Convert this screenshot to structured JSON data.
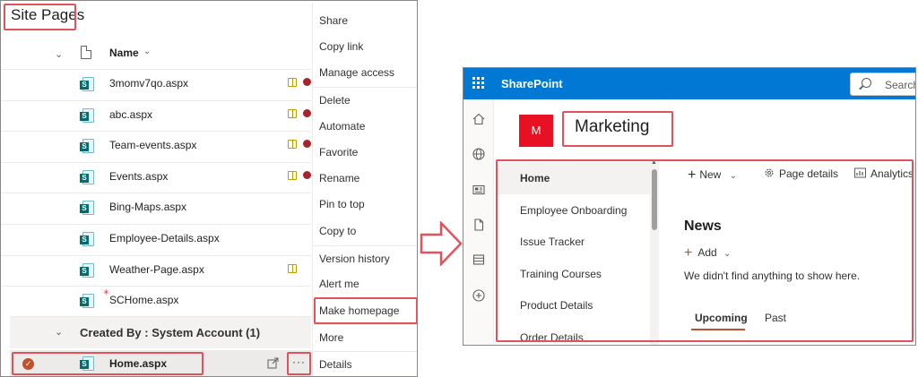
{
  "left": {
    "title": "Site Pages",
    "column_name": "Name",
    "files": [
      {
        "name": "3momv7qo.aspx",
        "book": true,
        "blocked": true
      },
      {
        "name": "abc.aspx",
        "book": true,
        "blocked": true
      },
      {
        "name": "Team-events.aspx",
        "book": true,
        "blocked": true
      },
      {
        "name": "Events.aspx",
        "book": true,
        "blocked": true
      },
      {
        "name": "Bing-Maps.aspx",
        "book": false,
        "blocked": false
      },
      {
        "name": "Employee-Details.aspx",
        "book": false,
        "blocked": false
      },
      {
        "name": "Weather-Page.aspx",
        "book": true,
        "blocked": false
      },
      {
        "name": "SCHome.aspx",
        "book": false,
        "blocked": false,
        "new": true
      }
    ],
    "group_label": "Created By : System Account (1)",
    "selected_file": "Home.aspx"
  },
  "context_menu": {
    "items": [
      "Share",
      "Copy link",
      "Manage access",
      "Delete",
      "Automate",
      "Favorite",
      "Rename",
      "Pin to top",
      "Copy to",
      "Version history",
      "Alert me",
      "Make homepage",
      "More",
      "Details"
    ]
  },
  "sharepoint": {
    "brand": "SharePoint",
    "search_placeholder": "Search",
    "site_logo": "M",
    "site_title": "Marketing",
    "nav": [
      "Home",
      "Employee Onboarding",
      "Issue Tracker",
      "Training Courses",
      "Product Details",
      "Order Details"
    ],
    "commands": {
      "new": "New",
      "page_details": "Page details",
      "analytics": "Analytics"
    },
    "news_title": "News",
    "add_label": "Add",
    "empty_text": "We didn't find anything to show here.",
    "tabs": [
      "Upcoming",
      "Past"
    ]
  },
  "colors": {
    "sp_blue": "#0078d4",
    "highlight_red": "#e0535b",
    "site_logo_red": "#e81123",
    "accent_orange": "#c1502e"
  },
  "icons": [
    "chevron-down-icon",
    "document-icon",
    "sharepoint-page-icon",
    "book-icon",
    "blocked-icon",
    "check-circle-icon",
    "share-icon",
    "more-icon",
    "waffle-icon",
    "search-icon",
    "home-icon",
    "globe-icon",
    "news-icon",
    "file-icon",
    "list-icon",
    "add-circle-icon",
    "arrow-right-icon",
    "gear-icon",
    "analytics-icon",
    "plus-icon"
  ]
}
